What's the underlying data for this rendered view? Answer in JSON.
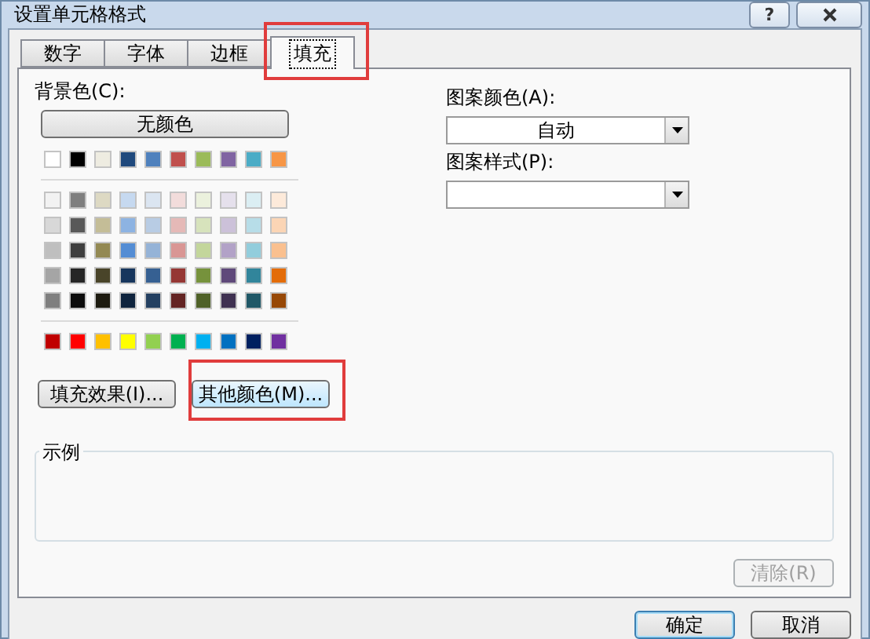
{
  "window": {
    "title": "设置单元格格式",
    "help": "?"
  },
  "tabs": [
    {
      "label": "数字",
      "selected": false,
      "highlighted": false
    },
    {
      "label": "字体",
      "selected": false,
      "highlighted": false
    },
    {
      "label": "边框",
      "selected": false,
      "highlighted": false
    },
    {
      "label": "填充",
      "selected": true,
      "highlighted": true
    }
  ],
  "background_color": {
    "label": "背景色(C):",
    "no_color_button": "无颜色",
    "theme_row": [
      {
        "color": "#ffffff"
      },
      {
        "color": "#000000"
      },
      {
        "color": "#eeece1"
      },
      {
        "color": "#1f497d"
      },
      {
        "color": "#4f81bd"
      },
      {
        "color": "#c0504d"
      },
      {
        "color": "#9bbb59"
      },
      {
        "color": "#8064a2"
      },
      {
        "color": "#4bacc6"
      },
      {
        "color": "#f79646"
      }
    ],
    "tint_rows": [
      [
        {
          "color": "#f2f2f2"
        },
        {
          "color": "#7f7f7f"
        },
        {
          "color": "#ddd9c3"
        },
        {
          "color": "#c6d9f0"
        },
        {
          "color": "#dbe5f1"
        },
        {
          "color": "#f2dcdb"
        },
        {
          "color": "#ebf1dd"
        },
        {
          "color": "#e5e0ec"
        },
        {
          "color": "#dbeef3"
        },
        {
          "color": "#fdeada"
        }
      ],
      [
        {
          "color": "#d8d8d8"
        },
        {
          "color": "#595959"
        },
        {
          "color": "#c4bd97"
        },
        {
          "color": "#8db3e2"
        },
        {
          "color": "#b8cce4"
        },
        {
          "color": "#e5b9b7"
        },
        {
          "color": "#d7e3bc"
        },
        {
          "color": "#ccc1d9"
        },
        {
          "color": "#b7dde8"
        },
        {
          "color": "#fbd5b5"
        }
      ],
      [
        {
          "color": "#bfbfbf"
        },
        {
          "color": "#3f3f3f"
        },
        {
          "color": "#938953"
        },
        {
          "color": "#548dd4"
        },
        {
          "color": "#95b3d7"
        },
        {
          "color": "#d99694"
        },
        {
          "color": "#c3d69b"
        },
        {
          "color": "#b2a2c7"
        },
        {
          "color": "#92cddc"
        },
        {
          "color": "#fac08f"
        }
      ],
      [
        {
          "color": "#a5a5a5"
        },
        {
          "color": "#262626"
        },
        {
          "color": "#494429"
        },
        {
          "color": "#17365d"
        },
        {
          "color": "#366092"
        },
        {
          "color": "#953734"
        },
        {
          "color": "#76923c"
        },
        {
          "color": "#5f497a"
        },
        {
          "color": "#31859b"
        },
        {
          "color": "#e36c09"
        }
      ],
      [
        {
          "color": "#7f7f7f"
        },
        {
          "color": "#0c0c0c"
        },
        {
          "color": "#1d1b10"
        },
        {
          "color": "#0f243e"
        },
        {
          "color": "#244061"
        },
        {
          "color": "#632423"
        },
        {
          "color": "#4f6128"
        },
        {
          "color": "#3f3151"
        },
        {
          "color": "#205867"
        },
        {
          "color": "#974806"
        }
      ]
    ],
    "standard_row": [
      {
        "color": "#c00000"
      },
      {
        "color": "#ff0000"
      },
      {
        "color": "#ffc000"
      },
      {
        "color": "#ffff00"
      },
      {
        "color": "#92d050"
      },
      {
        "color": "#00b050"
      },
      {
        "color": "#00b0f0"
      },
      {
        "color": "#0070c0"
      },
      {
        "color": "#002060"
      },
      {
        "color": "#7030a0"
      }
    ]
  },
  "fill_buttons": [
    {
      "label": "填充效果(I)...",
      "hovered": false,
      "highlighted": false
    },
    {
      "label": "其他颜色(M)...",
      "hovered": true,
      "highlighted": true
    }
  ],
  "pattern_color": {
    "label": "图案颜色(A):",
    "value": "自动"
  },
  "pattern_style": {
    "label": "图案样式(P):"
  },
  "sample": {
    "label": "示例"
  },
  "clear_button": {
    "label": "清除(R)",
    "disabled": true
  },
  "footer_buttons": [
    {
      "label": "确定",
      "default": true
    },
    {
      "label": "取消",
      "default": false
    }
  ]
}
